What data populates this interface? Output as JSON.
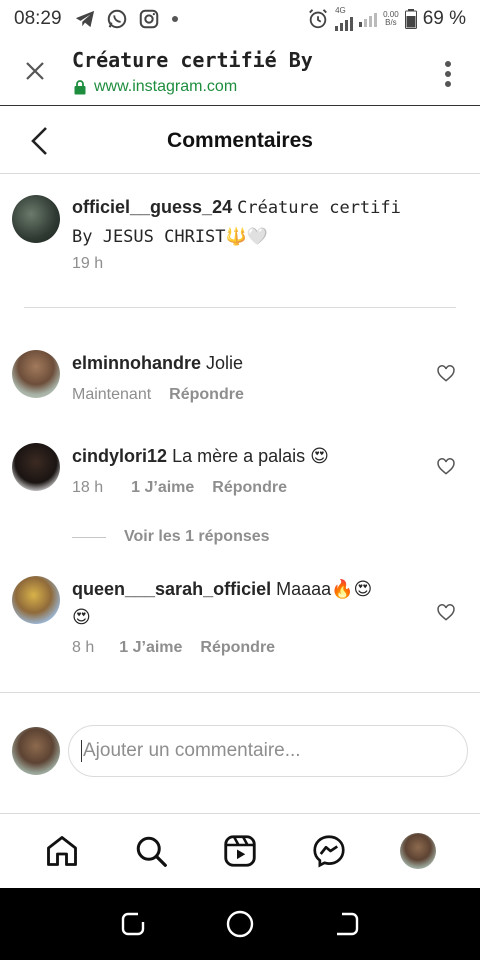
{
  "status_bar": {
    "time": "08:29",
    "network": "4G",
    "speed_value": "0.00",
    "speed_unit": "B/s",
    "battery": "69 %"
  },
  "browser": {
    "title": "Créature certifié By",
    "url": "www.instagram.com"
  },
  "header": {
    "title": "Commentaires"
  },
  "caption": {
    "username": "officiel__guess_24",
    "text_line1": "Créature certifi",
    "text_line2": "By JESUS CHRIST🔱🤍",
    "time": "19 h"
  },
  "comments": [
    {
      "username": "elminnohandre",
      "text": "Jolie",
      "time": "Maintenant",
      "likes": "",
      "reply_label": "Répondre"
    },
    {
      "username": "cindylori12",
      "text": "La mère a palais 😍",
      "time": "18 h",
      "likes": "1 J’aime",
      "reply_label": "Répondre"
    },
    {
      "username": "queen___sarah_officiel",
      "text": "Maaaa🔥😍",
      "text_line2": "😍",
      "time": "8 h",
      "likes": "1 J’aime",
      "reply_label": "Répondre"
    }
  ],
  "view_replies": "Voir les 1 réponses",
  "composer": {
    "placeholder": "Ajouter un commentaire..."
  },
  "colors": {
    "secure_green": "#1e8e3e",
    "muted": "#8e8e8e",
    "text": "#262626"
  }
}
